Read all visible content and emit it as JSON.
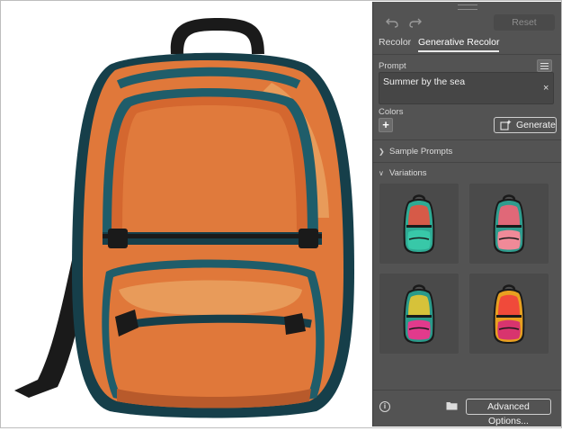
{
  "canvas": {
    "artwork": "backpack",
    "colors": {
      "orange_main": "#e0783a",
      "orange_light": "#e89b5a",
      "orange_dark": "#b85a2b",
      "teal": "#1f5d6a",
      "teal_dark": "#163f4a",
      "black": "#1a1a1a"
    }
  },
  "panel": {
    "icons": [
      "undo-icon",
      "redo-icon"
    ],
    "reset_label": "Reset",
    "tabs": [
      {
        "label": "Recolor",
        "active": false
      },
      {
        "label": "Generative Recolor",
        "active": true
      }
    ],
    "prompt": {
      "label": "Prompt",
      "value": "Summer by the sea",
      "clear_glyph": "×"
    },
    "colors": {
      "label": "Colors",
      "add_glyph": "+",
      "generate_label": "Generate"
    },
    "sample_prompts_label": "Sample Prompts",
    "variations": {
      "label": "Variations",
      "items": [
        {
          "body": "#d65a48",
          "trim": "#2eaa94",
          "accent": "#38c8a8"
        },
        {
          "body": "#e06878",
          "trim": "#2f9c8e",
          "accent": "#f08a98"
        },
        {
          "body": "#d6c23a",
          "trim": "#2a9a8a",
          "accent": "#e23a8c"
        },
        {
          "body": "#f04a3a",
          "trim": "#e8a020",
          "accent": "#d8346e"
        }
      ]
    },
    "footer": {
      "info_glyph": "i",
      "advanced_label": "Advanced Options..."
    }
  }
}
